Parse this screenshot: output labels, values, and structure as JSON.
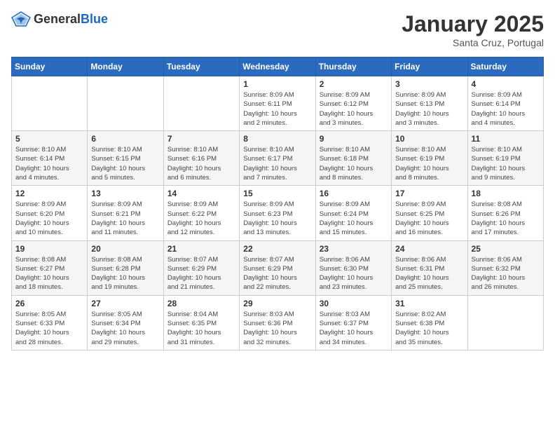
{
  "header": {
    "logo_general": "General",
    "logo_blue": "Blue",
    "month_title": "January 2025",
    "location": "Santa Cruz, Portugal"
  },
  "weekdays": [
    "Sunday",
    "Monday",
    "Tuesday",
    "Wednesday",
    "Thursday",
    "Friday",
    "Saturday"
  ],
  "weeks": [
    {
      "shade": "white",
      "days": [
        {
          "num": "",
          "info": ""
        },
        {
          "num": "",
          "info": ""
        },
        {
          "num": "",
          "info": ""
        },
        {
          "num": "1",
          "info": "Sunrise: 8:09 AM\nSunset: 6:11 PM\nDaylight: 10 hours\nand 2 minutes."
        },
        {
          "num": "2",
          "info": "Sunrise: 8:09 AM\nSunset: 6:12 PM\nDaylight: 10 hours\nand 3 minutes."
        },
        {
          "num": "3",
          "info": "Sunrise: 8:09 AM\nSunset: 6:13 PM\nDaylight: 10 hours\nand 3 minutes."
        },
        {
          "num": "4",
          "info": "Sunrise: 8:09 AM\nSunset: 6:14 PM\nDaylight: 10 hours\nand 4 minutes."
        }
      ]
    },
    {
      "shade": "shaded",
      "days": [
        {
          "num": "5",
          "info": "Sunrise: 8:10 AM\nSunset: 6:14 PM\nDaylight: 10 hours\nand 4 minutes."
        },
        {
          "num": "6",
          "info": "Sunrise: 8:10 AM\nSunset: 6:15 PM\nDaylight: 10 hours\nand 5 minutes."
        },
        {
          "num": "7",
          "info": "Sunrise: 8:10 AM\nSunset: 6:16 PM\nDaylight: 10 hours\nand 6 minutes."
        },
        {
          "num": "8",
          "info": "Sunrise: 8:10 AM\nSunset: 6:17 PM\nDaylight: 10 hours\nand 7 minutes."
        },
        {
          "num": "9",
          "info": "Sunrise: 8:10 AM\nSunset: 6:18 PM\nDaylight: 10 hours\nand 8 minutes."
        },
        {
          "num": "10",
          "info": "Sunrise: 8:10 AM\nSunset: 6:19 PM\nDaylight: 10 hours\nand 8 minutes."
        },
        {
          "num": "11",
          "info": "Sunrise: 8:10 AM\nSunset: 6:19 PM\nDaylight: 10 hours\nand 9 minutes."
        }
      ]
    },
    {
      "shade": "white",
      "days": [
        {
          "num": "12",
          "info": "Sunrise: 8:09 AM\nSunset: 6:20 PM\nDaylight: 10 hours\nand 10 minutes."
        },
        {
          "num": "13",
          "info": "Sunrise: 8:09 AM\nSunset: 6:21 PM\nDaylight: 10 hours\nand 11 minutes."
        },
        {
          "num": "14",
          "info": "Sunrise: 8:09 AM\nSunset: 6:22 PM\nDaylight: 10 hours\nand 12 minutes."
        },
        {
          "num": "15",
          "info": "Sunrise: 8:09 AM\nSunset: 6:23 PM\nDaylight: 10 hours\nand 13 minutes."
        },
        {
          "num": "16",
          "info": "Sunrise: 8:09 AM\nSunset: 6:24 PM\nDaylight: 10 hours\nand 15 minutes."
        },
        {
          "num": "17",
          "info": "Sunrise: 8:09 AM\nSunset: 6:25 PM\nDaylight: 10 hours\nand 16 minutes."
        },
        {
          "num": "18",
          "info": "Sunrise: 8:08 AM\nSunset: 6:26 PM\nDaylight: 10 hours\nand 17 minutes."
        }
      ]
    },
    {
      "shade": "shaded",
      "days": [
        {
          "num": "19",
          "info": "Sunrise: 8:08 AM\nSunset: 6:27 PM\nDaylight: 10 hours\nand 18 minutes."
        },
        {
          "num": "20",
          "info": "Sunrise: 8:08 AM\nSunset: 6:28 PM\nDaylight: 10 hours\nand 19 minutes."
        },
        {
          "num": "21",
          "info": "Sunrise: 8:07 AM\nSunset: 6:29 PM\nDaylight: 10 hours\nand 21 minutes."
        },
        {
          "num": "22",
          "info": "Sunrise: 8:07 AM\nSunset: 6:29 PM\nDaylight: 10 hours\nand 22 minutes."
        },
        {
          "num": "23",
          "info": "Sunrise: 8:06 AM\nSunset: 6:30 PM\nDaylight: 10 hours\nand 23 minutes."
        },
        {
          "num": "24",
          "info": "Sunrise: 8:06 AM\nSunset: 6:31 PM\nDaylight: 10 hours\nand 25 minutes."
        },
        {
          "num": "25",
          "info": "Sunrise: 8:06 AM\nSunset: 6:32 PM\nDaylight: 10 hours\nand 26 minutes."
        }
      ]
    },
    {
      "shade": "white",
      "days": [
        {
          "num": "26",
          "info": "Sunrise: 8:05 AM\nSunset: 6:33 PM\nDaylight: 10 hours\nand 28 minutes."
        },
        {
          "num": "27",
          "info": "Sunrise: 8:05 AM\nSunset: 6:34 PM\nDaylight: 10 hours\nand 29 minutes."
        },
        {
          "num": "28",
          "info": "Sunrise: 8:04 AM\nSunset: 6:35 PM\nDaylight: 10 hours\nand 31 minutes."
        },
        {
          "num": "29",
          "info": "Sunrise: 8:03 AM\nSunset: 6:36 PM\nDaylight: 10 hours\nand 32 minutes."
        },
        {
          "num": "30",
          "info": "Sunrise: 8:03 AM\nSunset: 6:37 PM\nDaylight: 10 hours\nand 34 minutes."
        },
        {
          "num": "31",
          "info": "Sunrise: 8:02 AM\nSunset: 6:38 PM\nDaylight: 10 hours\nand 35 minutes."
        },
        {
          "num": "",
          "info": ""
        }
      ]
    }
  ]
}
